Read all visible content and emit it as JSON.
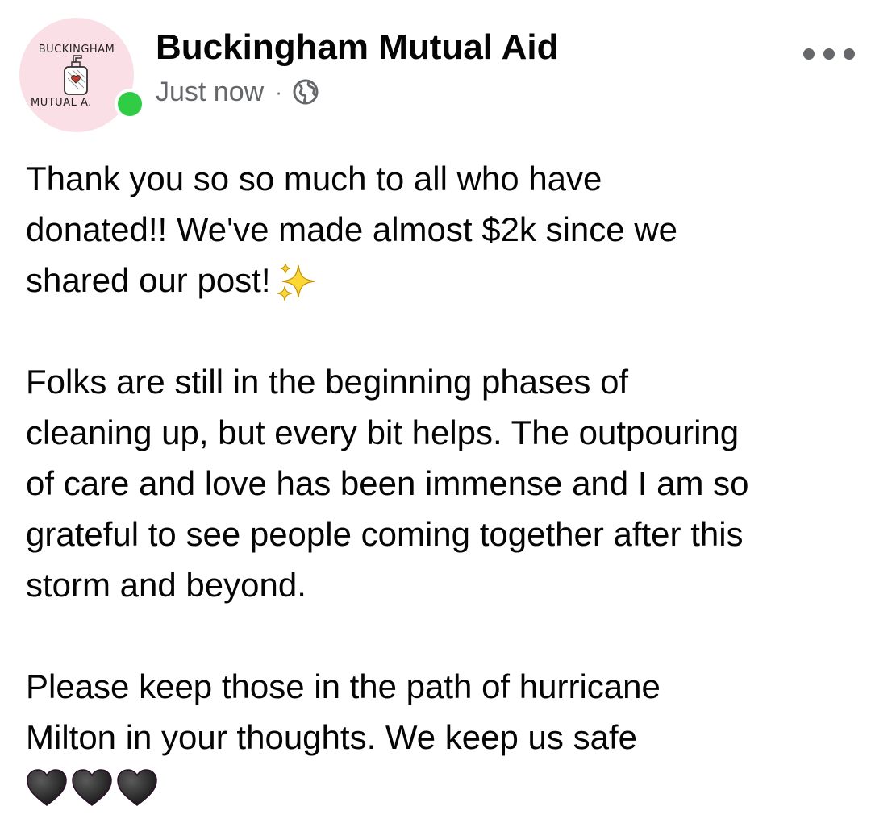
{
  "post": {
    "author": {
      "name": "Buckingham Mutual Aid",
      "avatar_text_top": "BUCKINGHAM",
      "avatar_text_bottom": "MUTUAL A.",
      "online": true
    },
    "timestamp": "Just now",
    "separator": "·",
    "audience_icon": "globe-icon",
    "menu_icon": "more-options-icon",
    "body": {
      "p1": [
        "Thank you so so much to all who have",
        "donated!! We've made almost $2k since we",
        "shared our post!"
      ],
      "p1_emoji": "sparkles-icon",
      "p2": [
        "Folks are still in the beginning phases of",
        "cleaning up, but every bit helps. The outpouring",
        "of care and love has been immense and I am so",
        "grateful to see people coming together after this",
        "storm and beyond."
      ],
      "p3": [
        "Please keep those in the path of hurricane",
        "Milton in your thoughts. We keep us safe"
      ],
      "p3_emoji": [
        "black-heart-icon",
        "black-heart-icon",
        "black-heart-icon"
      ]
    }
  },
  "colors": {
    "text_primary": "#050505",
    "text_secondary": "#65676b",
    "online_green": "#31cc46",
    "avatar_bg": "#fbdfe6"
  }
}
